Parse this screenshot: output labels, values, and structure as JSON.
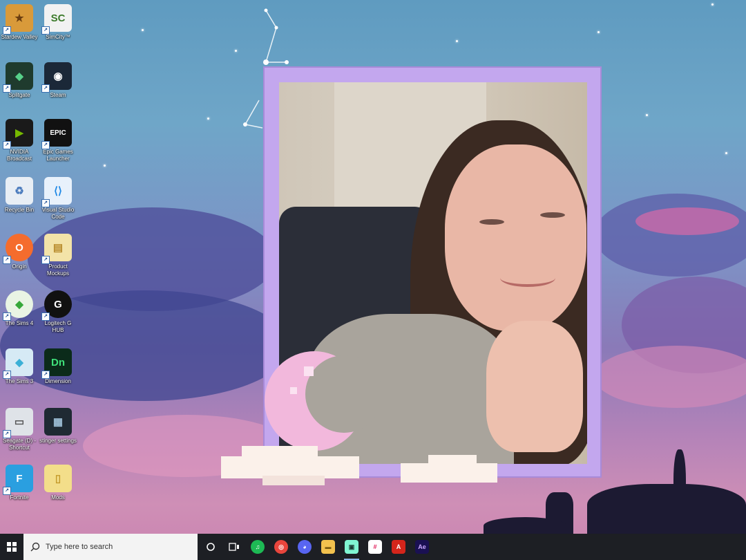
{
  "desktop": {
    "icons": [
      {
        "label": "Stardew Valley",
        "glyph": "★",
        "bg": "#d99a3a",
        "fg": "#6a3d10"
      },
      {
        "label": "SimCity™",
        "glyph": "SC",
        "bg": "#f2f2f2",
        "fg": "#3b7a2a"
      },
      {
        "label": "Splitgate",
        "glyph": "◆",
        "bg": "#1f3b2e",
        "fg": "#57d08a"
      },
      {
        "label": "Steam",
        "glyph": "◉",
        "bg": "#1b2838",
        "fg": "#ffffff"
      },
      {
        "label": "NVIDIA Broadcast",
        "glyph": "▶",
        "bg": "#1a1a1a",
        "fg": "#76b900"
      },
      {
        "label": "Epic Games Launcher",
        "glyph": "EPIC",
        "bg": "#111111",
        "fg": "#ffffff"
      },
      {
        "label": "Recycle Bin",
        "glyph": "♻",
        "bg": "#e8eef5",
        "fg": "#4a7bbd"
      },
      {
        "label": "Visual Studio Code",
        "glyph": "⟨⟩",
        "bg": "#e8f1fb",
        "fg": "#1e88e5"
      },
      {
        "label": "Origin",
        "glyph": "O",
        "bg": "#f56c2d",
        "fg": "#ffffff"
      },
      {
        "label": "Product Mockups",
        "glyph": "▤",
        "bg": "#f3e3a8",
        "fg": "#b78a2a"
      },
      {
        "label": "The Sims 4",
        "glyph": "◆",
        "bg": "#e9f4e4",
        "fg": "#36a83a"
      },
      {
        "label": "Logitech G HUB",
        "glyph": "G",
        "bg": "#111111",
        "fg": "#ffffff"
      },
      {
        "label": "The Sims 3",
        "glyph": "◆",
        "bg": "#d6eaf5",
        "fg": "#3bb0d6"
      },
      {
        "label": "Dimension",
        "glyph": "Dn",
        "bg": "#0b2b1a",
        "fg": "#3fe07a"
      },
      {
        "label": "Seagate (D) - Shortcut",
        "glyph": "▭",
        "bg": "#dfe3e8",
        "fg": "#555555"
      },
      {
        "label": "stinger settings",
        "glyph": "▦",
        "bg": "#1f2a33",
        "fg": "#9fc1d8"
      },
      {
        "label": "Fortnite",
        "glyph": "F",
        "bg": "#2a9fe0",
        "fg": "#ffffff"
      },
      {
        "label": "Mods",
        "glyph": "▯",
        "bg": "#f3de8a",
        "fg": "#c49a2a"
      }
    ]
  },
  "taskbar": {
    "search_placeholder": "Type here to search",
    "apps": [
      {
        "name": "Spotify",
        "glyph": "♫",
        "bg": "#1db954"
      },
      {
        "name": "Chrome",
        "glyph": "◎",
        "bg": "#e8453c"
      },
      {
        "name": "Discord",
        "glyph": "◕",
        "bg": "#5865f2"
      },
      {
        "name": "File Explorer",
        "glyph": "▬",
        "bg": "#f2c14e"
      },
      {
        "name": "Streamlabs",
        "glyph": "▣",
        "bg": "#80f5d2"
      },
      {
        "name": "Slack",
        "glyph": "#",
        "bg": "#e01e5a"
      },
      {
        "name": "Acrobat",
        "glyph": "A",
        "bg": "#d4251b"
      },
      {
        "name": "After Effects",
        "glyph": "Ae",
        "bg": "#1a1053"
      }
    ]
  },
  "colors": {
    "frame": "#c3a7ee",
    "taskbar": "#1d1f24"
  }
}
